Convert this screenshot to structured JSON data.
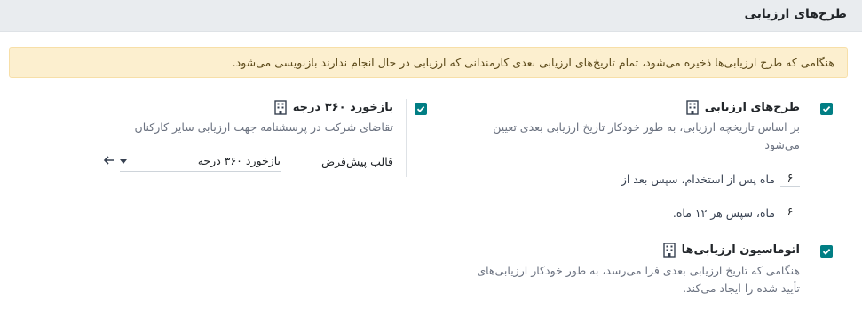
{
  "header": {
    "title": "طرح‌های ارزیابی"
  },
  "alert": {
    "text": "هنگامی که طرح ارزیابی‌ها ذخیره می‌شود، تمام تاریخ‌های ارزیابی بعدی کارمندانی که ارزیابی در حال انجام ندارند بازنویسی می‌شود."
  },
  "plans": {
    "title": "طرح‌های ارزیابی",
    "desc_line1": "بر اساس تاریخچه ارزیابی، به طور خودکار تاریخ ارزیابی بعدی تعیین",
    "desc_line2": "می‌شود",
    "first_value": "۶",
    "first_text": "ماه پس از استخدام، سپس بعد از",
    "second_value": "۶",
    "second_text": "ماه، سپس هر ۱۲ ماه."
  },
  "feedback360": {
    "title": "بازخورد ۳۶۰ درجه",
    "desc": "تقاضای شرکت در پرسشنامه جهت ارزیابی سایر کارکنان",
    "template_label": "قالب پیش‌فرض",
    "template_value": "بازخورد ۳۶۰ درجه"
  },
  "automation": {
    "title": "اتوماسیون ارزیابی‌ها",
    "desc_line1": "هنگامی که تاریخ ارزیابی بعدی فرا می‌رسد، به طور خودکار ارزیابی‌های",
    "desc_line2": "تأیید شده را ایجاد می‌کند."
  },
  "colors": {
    "accent": "#017e84",
    "alert_bg": "#fcefcf"
  }
}
